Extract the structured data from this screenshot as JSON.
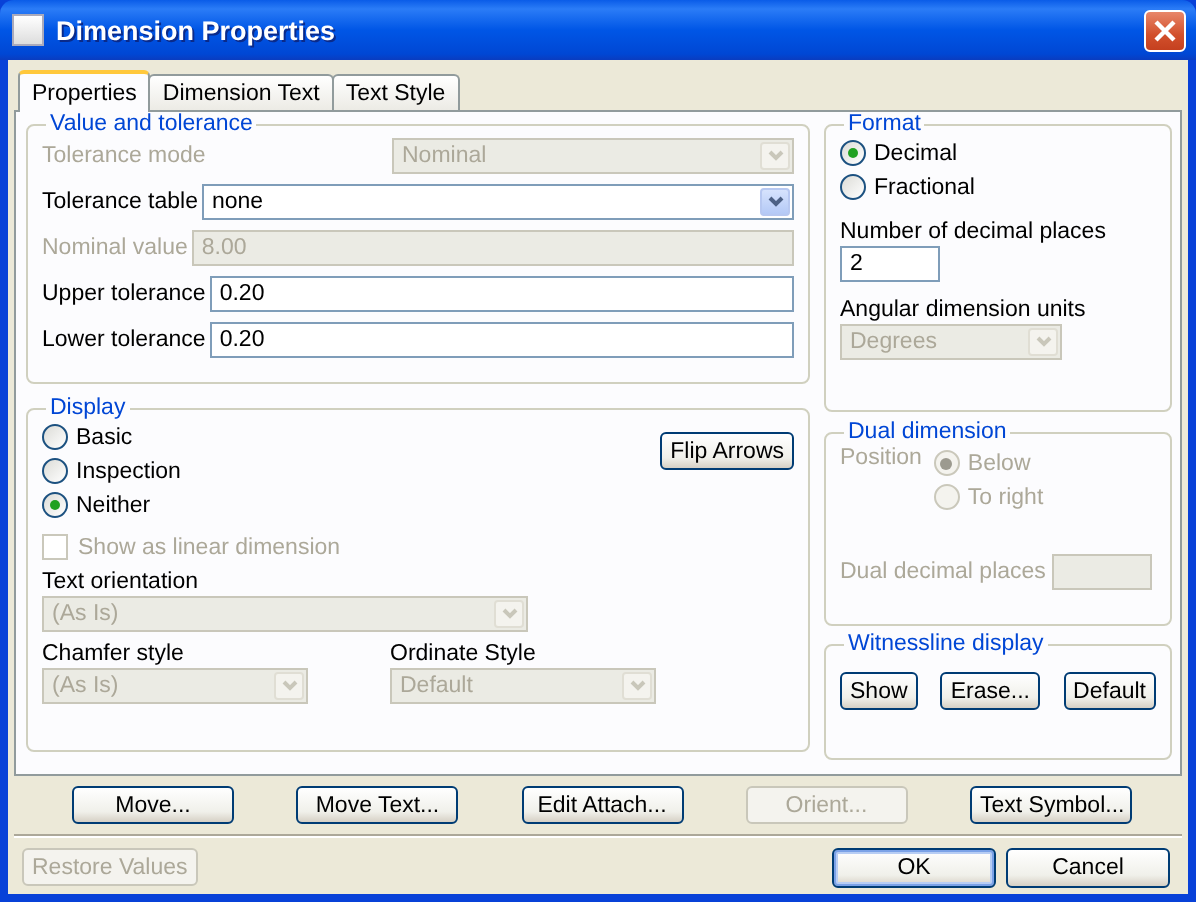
{
  "window": {
    "title": "Dimension Properties"
  },
  "tabs": [
    {
      "label": "Properties",
      "selected": true
    },
    {
      "label": "Dimension Text",
      "selected": false
    },
    {
      "label": "Text Style",
      "selected": false
    }
  ],
  "value_and_tolerance": {
    "title": "Value and tolerance",
    "fields": [
      {
        "label": "Tolerance mode",
        "value": "Nominal",
        "kind": "select",
        "disabled": true
      },
      {
        "label": "Tolerance table",
        "value": "none",
        "kind": "select",
        "disabled": false
      },
      {
        "label": "Nominal value",
        "value": "8.00",
        "kind": "input",
        "disabled": true
      },
      {
        "label": "Upper tolerance",
        "value": "0.20",
        "kind": "input",
        "disabled": false
      },
      {
        "label": "Lower tolerance",
        "value": "0.20",
        "kind": "input",
        "disabled": false
      }
    ]
  },
  "display": {
    "title": "Display",
    "options": [
      {
        "label": "Basic",
        "selected": false
      },
      {
        "label": "Inspection",
        "selected": false
      },
      {
        "label": "Neither",
        "selected": true
      }
    ],
    "flip_button": "Flip Arrows",
    "show_linear": {
      "label": "Show as linear dimension",
      "checked": false,
      "disabled": true
    },
    "text_orientation": {
      "label": "Text orientation",
      "value": "(As Is)",
      "disabled": true
    },
    "chamfer_style": {
      "label": "Chamfer style",
      "value": "(As Is)",
      "disabled": true
    },
    "ordinate_style": {
      "label": "Ordinate Style",
      "value": "Default",
      "disabled": true
    }
  },
  "format": {
    "title": "Format",
    "options": [
      {
        "label": "Decimal",
        "selected": true
      },
      {
        "label": "Fractional",
        "selected": false
      }
    ],
    "decimal_places": {
      "label": "Number of decimal places",
      "value": "2"
    },
    "angular_units": {
      "label": "Angular dimension units",
      "value": "Degrees",
      "disabled": true
    }
  },
  "dual_dimension": {
    "title": "Dual dimension",
    "disabled": true,
    "position_label": "Position",
    "options": [
      {
        "label": "Below",
        "selected": true
      },
      {
        "label": "To right",
        "selected": false
      }
    ],
    "decimal_places_label": "Dual decimal places"
  },
  "witnessline": {
    "title": "Witnessline display",
    "buttons": [
      "Show",
      "Erase...",
      "Default"
    ]
  },
  "action_buttons": [
    {
      "label": "Move...",
      "disabled": false
    },
    {
      "label": "Move Text...",
      "disabled": false
    },
    {
      "label": "Edit Attach...",
      "disabled": false
    },
    {
      "label": "Orient...",
      "disabled": true
    },
    {
      "label": "Text Symbol...",
      "disabled": false
    }
  ],
  "footer": {
    "restore": {
      "label": "Restore Values",
      "disabled": true
    },
    "buttons": [
      {
        "label": "OK",
        "default": true
      },
      {
        "label": "Cancel",
        "default": false
      }
    ]
  }
}
